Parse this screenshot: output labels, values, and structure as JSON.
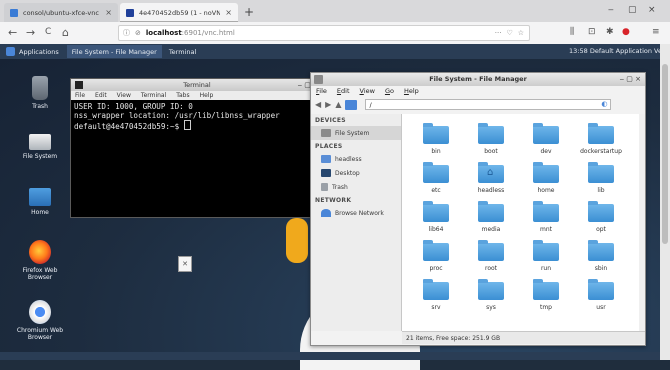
{
  "browser": {
    "tabs": [
      {
        "label": "consol/ubuntu-xfce-vnc - Doc",
        "close": "×"
      },
      {
        "label": "4e470452db59 (1 - noVNC",
        "close": "×"
      }
    ],
    "new_tab": "+",
    "window_controls": [
      "‒",
      "▢",
      "×"
    ],
    "nav": {
      "back": "←",
      "forward": "→",
      "reload": "C",
      "home": "⌂"
    },
    "url_host": "localhost",
    "url_path": ":6901/vnc.html",
    "url_icons": [
      "···",
      "♡",
      "☆"
    ],
    "toolbar_icons": [
      "⫼",
      "⊡",
      "✱",
      "●",
      "≡"
    ]
  },
  "panel": {
    "apps_label": "Applications",
    "tasks": [
      "File System - File Manager",
      "Terminal"
    ],
    "clock": "13:58 Default Application Ve"
  },
  "desktop_icons": [
    {
      "label": "Trash",
      "icon": "trash-icon"
    },
    {
      "label": "File System",
      "icon": "drive-icon"
    },
    {
      "label": "Home",
      "icon": "home-folder-icon"
    },
    {
      "label": "Firefox Web Browser",
      "icon": "firefox-icon"
    },
    {
      "label": "Chromium Web Browser",
      "icon": "chromium-icon"
    }
  ],
  "terminal": {
    "title": "Terminal",
    "menu": [
      "File",
      "Edit",
      "View",
      "Terminal",
      "Tabs",
      "Help"
    ],
    "lines": [
      "USER ID: 1000, GROUP ID: 0",
      "nss_wrapper location: /usr/lib/libnss_wrapper",
      "default@4e470452db59:~$ "
    ]
  },
  "file_manager": {
    "title": "File System - File Manager",
    "menu": [
      "File",
      "Edit",
      "View",
      "Go",
      "Help"
    ],
    "location": "/",
    "sections": [
      {
        "header": "DEVICES",
        "items": [
          {
            "label": "File System",
            "icon": "drive-icon",
            "selected": true
          }
        ]
      },
      {
        "header": "PLACES",
        "items": [
          {
            "label": "headless",
            "icon": "home-icon"
          },
          {
            "label": "Desktop",
            "icon": "desktop-icon"
          },
          {
            "label": "Trash",
            "icon": "trash-icon"
          }
        ]
      },
      {
        "header": "NETWORK",
        "items": [
          {
            "label": "Browse Network",
            "icon": "network-icon"
          }
        ]
      }
    ],
    "folders": [
      "bin",
      "boot",
      "dev",
      "dockerstartup",
      "etc",
      "headless",
      "home",
      "lib",
      "lib64",
      "media",
      "mnt",
      "opt",
      "proc",
      "root",
      "run",
      "sbin",
      "srv",
      "sys",
      "tmp",
      "usr"
    ],
    "status": "21 items, Free space: 251.9 GB"
  },
  "colors": {
    "panel": "#2a3d55",
    "folder": "#3b8fd3",
    "terminal_bg": "#000000"
  }
}
